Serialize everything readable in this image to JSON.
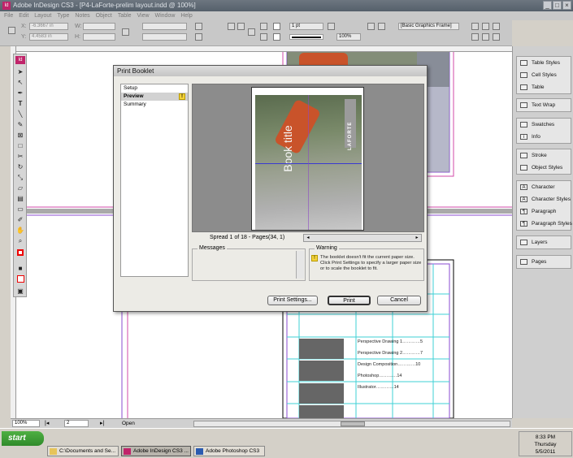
{
  "window": {
    "title": "Adobe InDesign CS3 - [P4-LaForte-prelim layout.indd @ 100%]",
    "app_icon": "Id"
  },
  "menubar": [
    "File",
    "Edit",
    "Layout",
    "Type",
    "Notes",
    "Object",
    "Table",
    "View",
    "Window",
    "Help"
  ],
  "controlbar": {
    "x_label": "X:",
    "x_value": "-6.3667 in",
    "y_label": "Y:",
    "y_value": "4.4583 in",
    "w_label": "W:",
    "h_label": "H:",
    "stroke_weight": "1 pt",
    "zoom": "100%",
    "object_style": "[Basic Graphics Frame]"
  },
  "right_panel": {
    "groups": [
      [
        {
          "label": "Table Styles",
          "icon": "table-styles-icon"
        },
        {
          "label": "Cell Styles",
          "icon": "cell-styles-icon"
        },
        {
          "label": "Table",
          "icon": "table-icon"
        }
      ],
      [
        {
          "label": "Text Wrap",
          "icon": "text-wrap-icon"
        }
      ],
      [
        {
          "label": "Swatches",
          "icon": "swatches-icon"
        },
        {
          "label": "Info",
          "icon": "info-icon"
        }
      ],
      [
        {
          "label": "Stroke",
          "icon": "stroke-icon"
        },
        {
          "label": "Object Styles",
          "icon": "object-styles-icon"
        }
      ],
      [
        {
          "label": "Character",
          "icon": "character-icon"
        },
        {
          "label": "Character Styles",
          "icon": "character-styles-icon"
        },
        {
          "label": "Paragraph",
          "icon": "paragraph-icon"
        },
        {
          "label": "Paragraph Styles",
          "icon": "paragraph-styles-icon"
        }
      ],
      [
        {
          "label": "Layers",
          "icon": "layers-icon"
        }
      ],
      [
        {
          "label": "Pages",
          "icon": "pages-icon"
        }
      ]
    ]
  },
  "document": {
    "toc_lines": [
      {
        "text": "Perspective Drawing 1",
        "page": "5"
      },
      {
        "text": "Perspective Drawing 2",
        "page": "7"
      },
      {
        "text": "Design Composition",
        "page": "10"
      },
      {
        "text": "Photoshop",
        "page": "14"
      },
      {
        "text": "Illustrator",
        "page": "14"
      }
    ]
  },
  "dialog": {
    "title": "Print Booklet",
    "steps": [
      {
        "label": "Setup",
        "selected": false,
        "warning": false
      },
      {
        "label": "Preview",
        "selected": true,
        "warning": true
      },
      {
        "label": "Summary",
        "selected": false,
        "warning": false
      }
    ],
    "preview": {
      "book_title": "Book title",
      "brand": "LAFORTE"
    },
    "spread_info": "Spread 1 of 18 - Pages(34, 1)",
    "messages_label": "Messages",
    "warning_label": "Warning",
    "warning_text": "The booklet doesn't fit the current paper size. Click Print Settings to specify a larger paper size or to scale the booklet to fit.",
    "buttons": {
      "print_settings": "Print Settings...",
      "print": "Print",
      "cancel": "Cancel"
    }
  },
  "statusbar": {
    "zoom": "100%",
    "page": "2",
    "status": "Open"
  },
  "taskbar": {
    "start": "start",
    "tasks": [
      {
        "label": "C:\\Documents and Se...",
        "active": false
      },
      {
        "label": "Adobe InDesign CS3 ...",
        "active": true
      },
      {
        "label": "Adobe Photoshop CS3",
        "active": false
      }
    ],
    "clock": {
      "time": "8:33 PM",
      "day": "Thursday",
      "date": "5/5/2011"
    }
  }
}
